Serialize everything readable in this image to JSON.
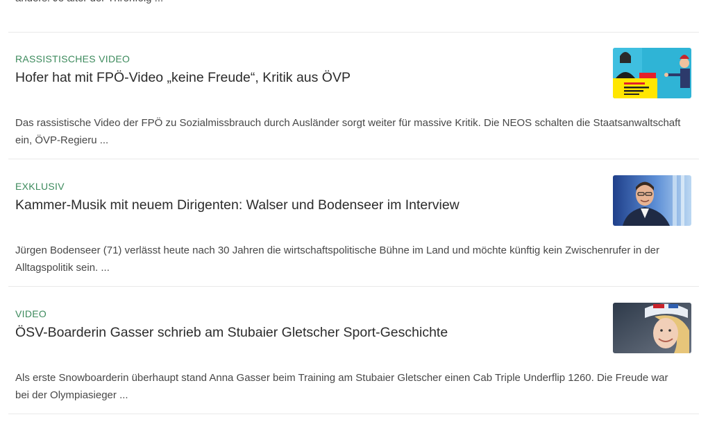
{
  "partial_article": {
    "teaser_tail_line1": "",
    "teaser_tail_line2": "anders. Je älter der Thronfolg ..."
  },
  "articles": [
    {
      "kicker": "RASSISTISCHES VIDEO",
      "headline": "Hofer hat mit FPÖ-Video „keine Freude“, Kritik aus ÖVP",
      "teaser": "Das rassistische Video der FPÖ zu Sozialmissbrauch durch Ausländer sorgt weiter für massive Kritik. Die NEOS schalten die Staatsanwaltschaft ein, ÖVP-Regieru ...",
      "thumbnail_icon": "cartoon-video-still-icon"
    },
    {
      "kicker": "EXKLUSIV",
      "headline": "Kammer-Musik mit neuem Dirigenten: Walser und Bodenseer im Interview",
      "teaser": "Jürgen Bodenseer (71) verlässt heute nach 30 Jahren die wirtschaftspolitische Bühne im Land und möchte künftig kein Zwischenrufer in der Alltagspolitik sein. ...",
      "thumbnail_icon": "portrait-photo-icon"
    },
    {
      "kicker": "VIDEO",
      "headline": "ÖSV-Boarderin Gasser schrieb am Stubaier Gletscher Sport-Geschichte",
      "teaser": "Als erste Snowboarderin überhaupt stand Anna Gasser beim Training am Stubaier Gletscher einen Cab Triple Underflip 1260. Die Freude war bei der Olympiasieger ...",
      "thumbnail_icon": "snowboarder-photo-icon"
    }
  ],
  "colors": {
    "kicker": "#3c8a5c",
    "headline": "#2b2b2b",
    "teaser": "#474747",
    "divider": "#e9e9e9"
  }
}
